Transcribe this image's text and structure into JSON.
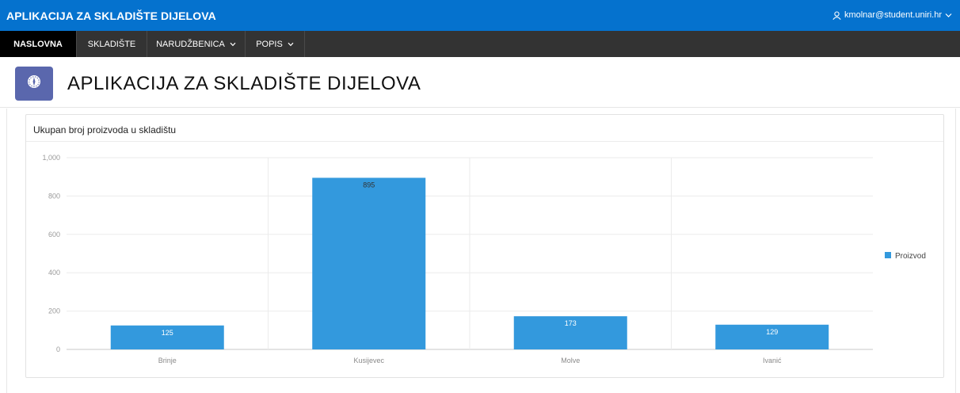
{
  "header": {
    "app_title": "APLIKACIJA ZA SKLADIŠTE DIJELOVA",
    "user_email": "kmolnar@student.uniri.hr",
    "user_icon": "user-icon",
    "color": "#0572ce"
  },
  "nav": {
    "items": [
      {
        "label": "NASLOVNA",
        "active": true
      },
      {
        "label": "SKLADIŠTE"
      },
      {
        "label": "NARUDŽBENICA",
        "has_dropdown": true
      },
      {
        "label": "POPIS",
        "has_dropdown": true
      }
    ]
  },
  "page": {
    "title": "APLIKACIJA ZA SKLADIŠTE DIJELOVA",
    "icon": "compass-icon"
  },
  "panel": {
    "title": "Ukupan broj proizvoda u skladištu"
  },
  "chart_data": {
    "type": "bar",
    "categories": [
      "Brinje",
      "Kusijevec",
      "Molve",
      "Ivanić"
    ],
    "series": [
      {
        "name": "Proizvod",
        "values": [
          125,
          895,
          173,
          129
        ],
        "color": "#3399dd"
      }
    ],
    "data_labels": [
      "125",
      "895",
      "173",
      "129"
    ],
    "y_ticks": [
      "0",
      "200",
      "400",
      "600",
      "800",
      "1,000"
    ],
    "ylim": [
      0,
      1000
    ],
    "grid": true,
    "legend": "right"
  }
}
